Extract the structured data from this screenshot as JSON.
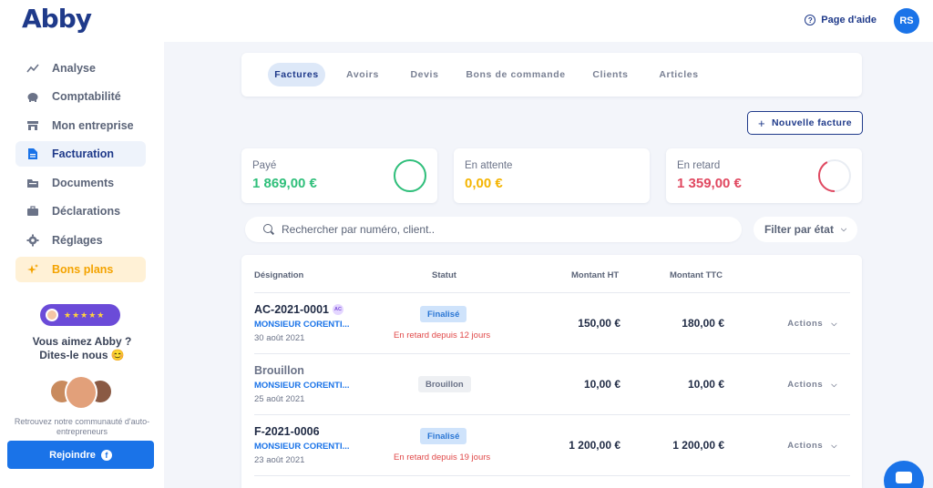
{
  "brand": {
    "logo": "Abby",
    "accent": "#1a73e8",
    "navy": "#1f3a8a"
  },
  "topbar": {
    "help_label": "Page d'aide",
    "help_icon": "question-circle-icon",
    "avatar_initials": "RS"
  },
  "sidebar": {
    "items": [
      {
        "label": "Analyse",
        "icon": "chart-line-icon",
        "state": "normal"
      },
      {
        "label": "Comptabilité",
        "icon": "piggy-bank-icon",
        "state": "normal"
      },
      {
        "label": "Mon entreprise",
        "icon": "store-icon",
        "state": "normal"
      },
      {
        "label": "Facturation",
        "icon": "document-icon",
        "state": "active"
      },
      {
        "label": "Documents",
        "icon": "folder-icon",
        "state": "normal"
      },
      {
        "label": "Déclarations",
        "icon": "briefcase-icon",
        "state": "normal"
      },
      {
        "label": "Réglages",
        "icon": "gear-icon",
        "state": "normal"
      },
      {
        "label": "Bons plans",
        "icon": "sparkles-icon",
        "state": "promo"
      }
    ],
    "promo": {
      "rating_stars": "★★★★★",
      "love_line1": "Vous aimez Abby ?",
      "love_line2": "Dites-le nous 😊",
      "community_text": "Retrouvez notre communauté d'auto-entrepreneurs",
      "join_label": "Rejoindre",
      "join_icon": "facebook-icon"
    }
  },
  "tabs": [
    {
      "label": "Factures",
      "active": true
    },
    {
      "label": "Avoirs",
      "active": false
    },
    {
      "label": "Devis",
      "active": false
    },
    {
      "label": "Bons de commande",
      "active": false
    },
    {
      "label": "Clients",
      "active": false
    },
    {
      "label": "Articles",
      "active": false
    }
  ],
  "new_invoice_label": "Nouvelle facture",
  "stats": [
    {
      "label": "Payé",
      "value": "1 869,00 €",
      "color": "#2fbf7a",
      "progress": 1.0
    },
    {
      "label": "En attente",
      "value": "0,00 €",
      "color": "#f4b400",
      "progress": 0.0
    },
    {
      "label": "En retard",
      "value": "1 359,00 €",
      "color": "#e04860",
      "progress": 0.42
    }
  ],
  "search": {
    "placeholder": "Rechercher par numéro, client.."
  },
  "filter_label": "Filter par état",
  "table": {
    "headers": {
      "designation": "Désignation",
      "status": "Statut",
      "ht": "Montant HT",
      "ttc": "Montant TTC"
    },
    "rows": [
      {
        "title": "AC-2021-0001",
        "badge": "AC",
        "client": "MONSIEUR CORENTI...",
        "date": "30 août 2021",
        "status": "Finalisé",
        "late": "En retard depuis 12 jours",
        "ht": "150,00 €",
        "ttc": "180,00 €",
        "actions": "Actions"
      },
      {
        "title": "Brouillon",
        "badge": "",
        "client": "MONSIEUR CORENTI...",
        "date": "25 août 2021",
        "status": "Brouillon",
        "late": "",
        "ht": "10,00 €",
        "ttc": "10,00 €",
        "actions": "Actions"
      },
      {
        "title": "F-2021-0006",
        "badge": "",
        "client": "MONSIEUR CORENTI...",
        "date": "23 août 2021",
        "status": "Finalisé",
        "late": "En retard depuis 19 jours",
        "ht": "1 200,00 €",
        "ttc": "1 200,00 €",
        "actions": "Actions"
      }
    ]
  }
}
